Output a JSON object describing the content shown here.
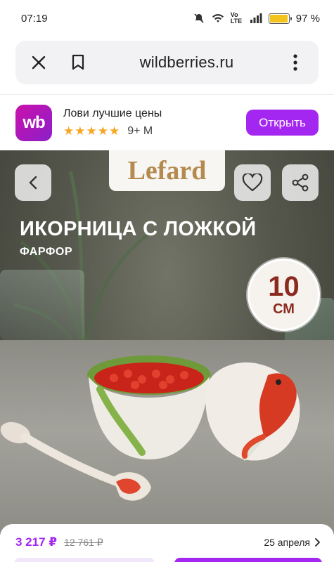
{
  "status_bar": {
    "time": "07:19",
    "battery_text": "97 %",
    "battery_level": 0.97,
    "network_label": "Vo LTE"
  },
  "browser": {
    "url": "wildberries.ru"
  },
  "app_banner": {
    "logo_text": "wb",
    "title": "Лови лучшие цены",
    "stars": "★★★★★",
    "installs": "9+ M",
    "open_label": "Открыть"
  },
  "product": {
    "brand": "Lefard",
    "headline": "ИКОРНИЦА С ЛОЖКОЙ",
    "subline": "ФАРФОР",
    "size_value": "10",
    "size_unit": "СМ"
  },
  "purchase": {
    "price": "3 217 ₽",
    "old_price": "12 761 ₽",
    "delivery_date": "25 апреля"
  },
  "colors": {
    "accent": "#a327f0",
    "wb_gradient_start": "#cb11ab",
    "wb_gradient_end": "#8b1fc9",
    "badge_text": "#8b2a1e",
    "brand_text": "#b48a4e"
  }
}
